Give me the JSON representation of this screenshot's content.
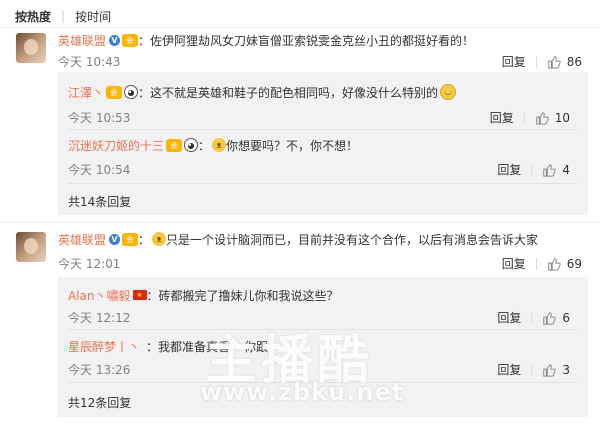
{
  "tabs": {
    "hot": "按热度",
    "sep": "|",
    "time": "按时间"
  },
  "icons": {
    "like": "thumb-up-icon",
    "verified": "v-verified-icon"
  },
  "colors": {
    "username": "#eb7350",
    "meta": "#808080",
    "subbg": "#f2f2f5",
    "verified": "#3a7be0"
  },
  "comments": [
    {
      "user": "英雄联盟",
      "badge": "V",
      "text": "：佐伊阿狸劫风女刀妹盲僧亚索锐雯金克丝小丑的都挺好看的！",
      "time": "今天 10:43",
      "reply": "回复",
      "likes": "86",
      "replies": [
        {
          "user": "江澤丶",
          "colon": "：",
          "text": "这不就是英雄和鞋子的配色相同吗，好像没什么特别的",
          "time": "今天 10:53",
          "reply": "回复",
          "likes": "10"
        },
        {
          "user": "沉迷妖刀姬的十三",
          "colon": "：",
          "text": "你想要吗？不，你不想！",
          "time": "今天 10:54",
          "reply": "回复",
          "likes": "4"
        }
      ],
      "more": "共14条回复"
    },
    {
      "user": "英雄联盟",
      "badge": "V",
      "text": "只是一个设计脑洞而已，目前并没有这个合作，以后有消息会告诉大家",
      "time": "今天 12:01",
      "reply": "回复",
      "likes": "69",
      "replies": [
        {
          "user": "Alan丶嘯毅",
          "colon": "：",
          "text": "砖都搬完了撸妹儿你和我说这些？",
          "time": "今天 12:12",
          "reply": "回复",
          "likes": "6"
        },
        {
          "user": "星辰醉梦丨丶",
          "colon": "：",
          "text": "我都准备真香",
          "text2": "你跟",
          "time": "今天 13:26",
          "reply": "回复",
          "likes": "3"
        }
      ],
      "more": "共12条回复"
    }
  ],
  "watermark": {
    "brand": "主播酷",
    "url": "www.zbku.net"
  }
}
